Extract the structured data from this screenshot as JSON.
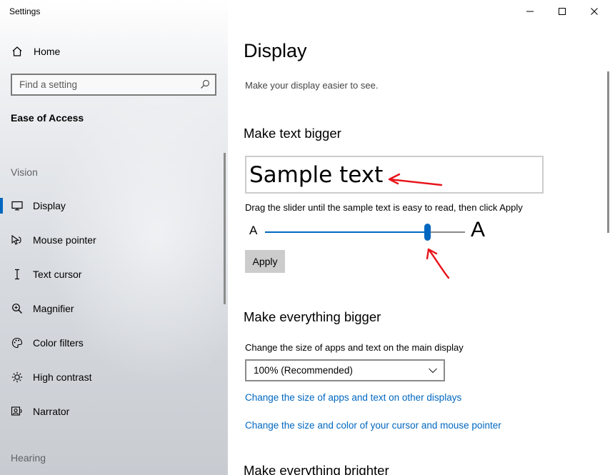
{
  "window": {
    "title": "Settings",
    "controls": {
      "minimize": "minimize-icon",
      "maximize": "maximize-icon",
      "close": "close-icon"
    }
  },
  "sidebar": {
    "home_label": "Home",
    "search": {
      "placeholder": "Find a setting"
    },
    "section_title": "Ease of Access",
    "groups": [
      {
        "label": "Vision",
        "items": [
          {
            "label": "Display",
            "icon": "monitor-icon",
            "selected": true
          },
          {
            "label": "Mouse pointer",
            "icon": "mouse-pointer-icon"
          },
          {
            "label": "Text cursor",
            "icon": "text-cursor-icon"
          },
          {
            "label": "Magnifier",
            "icon": "magnifier-icon"
          },
          {
            "label": "Color filters",
            "icon": "color-filters-icon"
          },
          {
            "label": "High contrast",
            "icon": "high-contrast-icon"
          },
          {
            "label": "Narrator",
            "icon": "narrator-icon"
          }
        ]
      },
      {
        "label": "Hearing",
        "items": []
      }
    ]
  },
  "main": {
    "title": "Display",
    "description": "Make your display easier to see.",
    "text_bigger": {
      "heading": "Make text bigger",
      "sample_text": "Sample text",
      "hint": "Drag the slider until the sample text is easy to read, then click Apply",
      "slider_min_label": "A",
      "slider_max_label": "A",
      "slider_value_fraction": 0.81,
      "apply_label": "Apply"
    },
    "everything_bigger": {
      "heading": "Make everything bigger",
      "label": "Change the size of apps and text on the main display",
      "dropdown_value": "100% (Recommended)",
      "links": [
        "Change the size of apps and text on other displays",
        "Change the size and color of your cursor and mouse pointer"
      ]
    },
    "brighter_heading": "Make everything brighter"
  },
  "colors": {
    "accent": "#0067c0",
    "annotation": "#e8141b",
    "link": "#0067c0"
  }
}
